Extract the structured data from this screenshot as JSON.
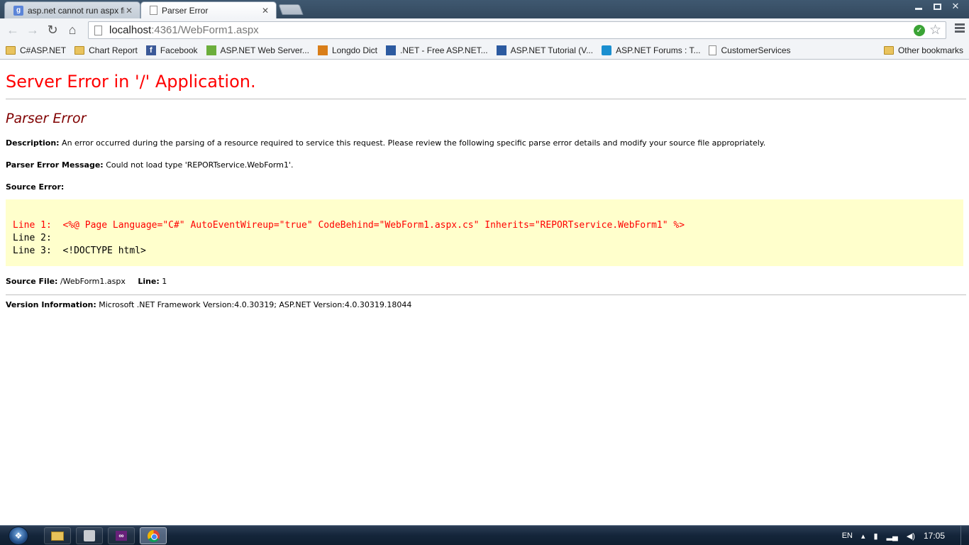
{
  "tabs": [
    {
      "title": "asp.net cannot run aspx fil",
      "icon": "google-favicon",
      "active": false
    },
    {
      "title": "Parser Error",
      "icon": "page-favicon",
      "active": true
    }
  ],
  "window_controls": {
    "minimize": "–",
    "maximize": "□",
    "close": "✕"
  },
  "toolbar": {
    "back": "←",
    "forward": "→",
    "reload": "↻",
    "home": "⌂",
    "url_host": "localhost",
    "url_rest": ":4361/WebForm1.aspx"
  },
  "bookmarks": [
    {
      "label": "C#ASP.NET",
      "icon": "folder-icon"
    },
    {
      "label": "Chart Report",
      "icon": "folder-icon"
    },
    {
      "label": "Facebook",
      "icon": "facebook-icon"
    },
    {
      "label": "ASP.NET Web Server...",
      "icon": "asp-icon"
    },
    {
      "label": "Longdo Dict",
      "icon": "longdo-icon"
    },
    {
      "label": ".NET - Free ASP.NET...",
      "icon": "dotnet-icon"
    },
    {
      "label": "ASP.NET Tutorial (V...",
      "icon": "dotnet-icon"
    },
    {
      "label": "ASP.NET Forums : T...",
      "icon": "forum-icon"
    },
    {
      "label": "CustomerServices",
      "icon": "page-icon"
    }
  ],
  "other_bookmarks": "Other bookmarks",
  "page": {
    "title": "Server Error in '/' Application.",
    "subtitle": "Parser Error",
    "description_label": "Description:",
    "description": "An error occurred during the parsing of a resource required to service this request. Please review the following specific parse error details and modify your source file appropriately.",
    "message_label": "Parser Error Message:",
    "message": "Could not load type 'REPORTservice.WebForm1'.",
    "source_error_label": "Source Error:",
    "code_lines": [
      {
        "text": "Line 1:  <%@ Page Language=\"C#\" AutoEventWireup=\"true\" CodeBehind=\"WebForm1.aspx.cs\" Inherits=\"REPORTservice.WebForm1\" %>",
        "error": true
      },
      {
        "text": "Line 2:",
        "error": false
      },
      {
        "text": "Line 3:  <!DOCTYPE html>",
        "error": false
      }
    ],
    "source_file_label": "Source File:",
    "source_file": "/WebForm1.aspx",
    "line_label": "Line:",
    "line_number": "1",
    "version_label": "Version Information:",
    "version": "Microsoft .NET Framework Version:4.0.30319; ASP.NET Version:4.0.30319.18044"
  },
  "taskbar": {
    "language": "EN",
    "clock": "17:05",
    "apps": [
      "file-explorer",
      "tool",
      "visual-studio",
      "chrome"
    ]
  }
}
